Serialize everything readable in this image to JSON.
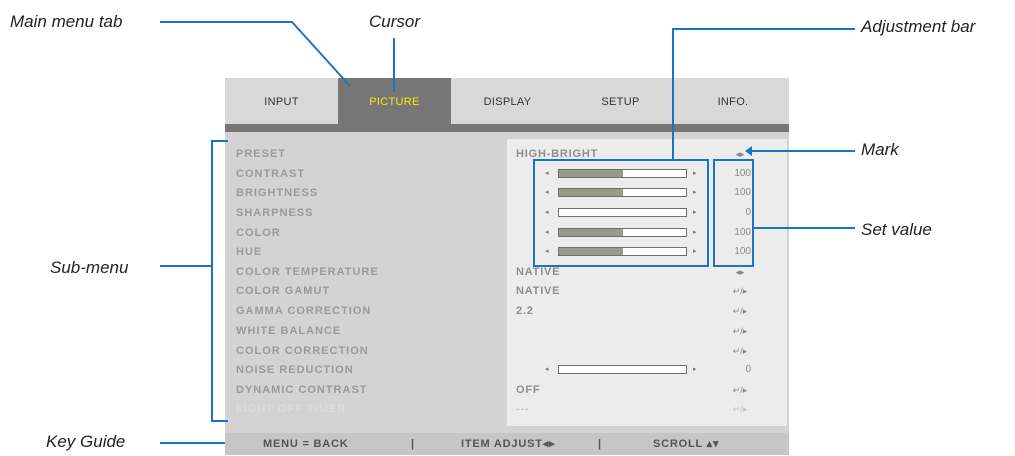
{
  "callouts": {
    "main_menu_tab": "Main menu tab",
    "cursor": "Cursor",
    "adjustment_bar": "Adjustment bar",
    "mark": "Mark",
    "set_value": "Set value",
    "sub_menu": "Sub-menu",
    "key_guide": "Key Guide"
  },
  "tabs": [
    {
      "label": "INPUT",
      "active": false
    },
    {
      "label": "PICTURE",
      "active": true
    },
    {
      "label": "DISPLAY",
      "active": false
    },
    {
      "label": "SETUP",
      "active": false
    },
    {
      "label": "INFO.",
      "active": false
    }
  ],
  "rows": [
    {
      "label": "PRESET",
      "value": "HIGH-BRIGHT",
      "mark": "◂▸"
    },
    {
      "label": "CONTRAST",
      "bar_level": 0.5,
      "number": "100"
    },
    {
      "label": "BRIGHTNESS",
      "bar_level": 0.5,
      "number": "100"
    },
    {
      "label": "SHARPNESS",
      "bar_level": 0.0,
      "number": "0"
    },
    {
      "label": "COLOR",
      "bar_level": 0.5,
      "number": "100"
    },
    {
      "label": "HUE",
      "bar_level": 0.5,
      "number": "100"
    },
    {
      "label": "COLOR TEMPERATURE",
      "value": "NATIVE",
      "mark": "◂▸"
    },
    {
      "label": "COLOR GAMUT",
      "value": "NATIVE",
      "mark": "↵/▸"
    },
    {
      "label": "GAMMA CORRECTION",
      "value": "2.2",
      "mark": "↵/▸"
    },
    {
      "label": "WHITE BALANCE",
      "mark": "↵/▸"
    },
    {
      "label": "COLOR CORRECTION",
      "mark": "↵/▸"
    },
    {
      "label": "NOISE REDUCTION",
      "bar_level": 0.0,
      "number": "0"
    },
    {
      "label": "DYNAMIC CONTRAST",
      "value": "OFF",
      "mark": "↵/▸"
    },
    {
      "label": "LIGHT OFF TIMER",
      "value": "---",
      "mark": "↵/▸",
      "disabled": true
    }
  ],
  "key_guide": {
    "back": "MENU = BACK",
    "sep1": "|",
    "adjust": "ITEM ADJUST◂▸",
    "sep2": "|",
    "scroll": "SCROLL ▴▾"
  },
  "colors": {
    "active_tab_text": "#ffe600",
    "active_tab_bg": "#777777",
    "callout_line": "#1a73c4"
  }
}
